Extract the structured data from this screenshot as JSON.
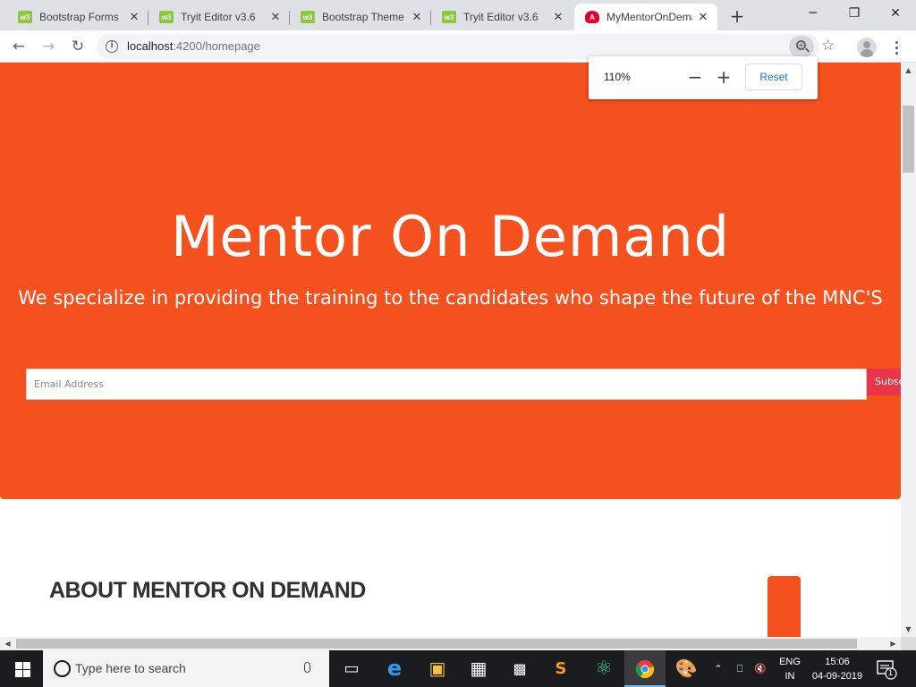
{
  "browser": {
    "tabs": [
      {
        "title": "Bootstrap Forms",
        "icon": "w3schools-icon"
      },
      {
        "title": "Tryit Editor v3.6",
        "icon": "w3schools-icon"
      },
      {
        "title": "Bootstrap Theme",
        "icon": "w3schools-icon"
      },
      {
        "title": "Tryit Editor v3.6",
        "icon": "w3schools-icon"
      },
      {
        "title": "MyMentorOnDemand",
        "icon": "angular-icon"
      }
    ],
    "new_tab": "+",
    "minimize": "─",
    "restore": "❐",
    "close_window": "✕",
    "close_tab": "✕",
    "url_host": "localhost",
    "url_path": ":4200/homepage",
    "zoom": {
      "percent": "110%",
      "minus": "−",
      "plus": "+",
      "reset": "Reset"
    }
  },
  "page": {
    "hero_title": "Mentor On Demand",
    "hero_subtitle": "We specialize in providing the training to the candidates who shape the future of the MNC'S",
    "email_placeholder": "Email Address",
    "subscribe_label": "Subscribe",
    "about_heading": "ABOUT MENTOR ON DEMAND",
    "accent_color": "#f5511e"
  },
  "taskbar": {
    "search_placeholder": "Type here to search",
    "language_line1": "ENG",
    "language_line2": "IN",
    "time": "15:06",
    "date": "04-09-2019",
    "notification_count": "1"
  }
}
